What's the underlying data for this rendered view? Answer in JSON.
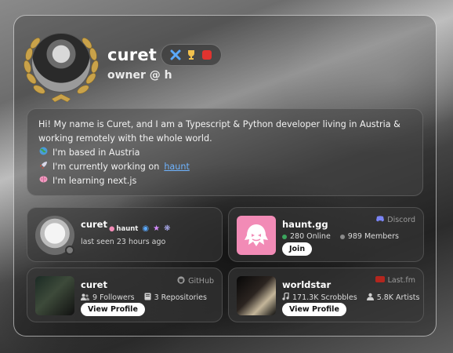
{
  "profile": {
    "username": "curet",
    "subtitle": "owner @ h",
    "badges": [
      "close-badge-icon",
      "trophy-badge-icon",
      "red-badge-icon"
    ]
  },
  "bio": {
    "intro": "Hi! My name is Curet, and I am a Typescript & Python developer living in Austria & working remotely with the whole world.",
    "items": [
      {
        "icon": "globe-icon",
        "text": "I'm based in Austria"
      },
      {
        "icon": "rocket-icon",
        "text": "I'm currently working on ",
        "link": "haunt"
      },
      {
        "icon": "brain-icon",
        "text": "I'm learning next.js"
      }
    ]
  },
  "discord_user": {
    "name": "curet",
    "tag": "haunt",
    "last_seen": "last seen 23 hours ago"
  },
  "server": {
    "name": "haunt.gg",
    "brand": "Discord",
    "online": "280 Online",
    "members": "989 Members",
    "join_label": "Join"
  },
  "github": {
    "name": "curet",
    "brand": "GitHub",
    "followers": "9 Followers",
    "repos": "3 Repositories",
    "button": "View Profile"
  },
  "lastfm": {
    "name": "worldstar",
    "brand": "Last.fm",
    "scrobbles": "171.3K Scrobbles",
    "artists": "5.8K Artists",
    "button": "View Profile"
  },
  "colors": {
    "online": "#3ba55d",
    "offline": "#7a7a7a",
    "link": "#6fb4ff",
    "discord": "#5865f2",
    "lastfm": "#d51007"
  }
}
